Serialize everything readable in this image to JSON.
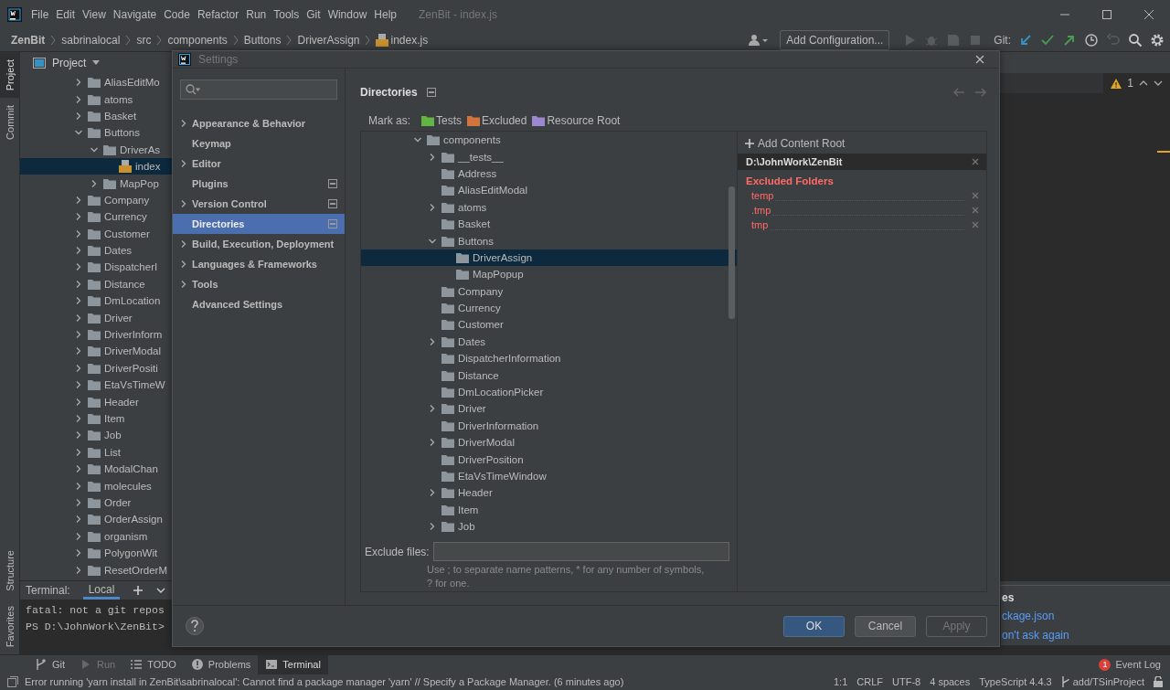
{
  "window": {
    "title": "ZenBit - index.js"
  },
  "menu": [
    "File",
    "Edit",
    "View",
    "Navigate",
    "Code",
    "Refactor",
    "Run",
    "Tools",
    "Git",
    "Window",
    "Help"
  ],
  "breadcrumbs": [
    {
      "label": "ZenBit",
      "kind": "project"
    },
    {
      "label": "sabrinalocal",
      "kind": "folder"
    },
    {
      "label": "src",
      "kind": "folder"
    },
    {
      "label": "components",
      "kind": "folder"
    },
    {
      "label": "Buttons",
      "kind": "folder"
    },
    {
      "label": "DriverAssign",
      "kind": "folder"
    },
    {
      "label": "index.js",
      "kind": "file"
    }
  ],
  "toolbar": {
    "run_configuration": "Add Configuration...",
    "vcs_label": "Git:"
  },
  "tool_stripe": {
    "top": [
      {
        "label": "Project",
        "selected": true
      },
      {
        "label": "Commit",
        "selected": false
      }
    ],
    "bottom": [
      {
        "label": "Structure",
        "selected": false
      },
      {
        "label": "Favorites",
        "selected": false
      }
    ]
  },
  "project_panel": {
    "title": "Project",
    "tree": [
      {
        "label": "AliasEditMo",
        "expanded": false,
        "selected": false
      },
      {
        "label": "atoms",
        "expanded": false,
        "selected": false
      },
      {
        "label": "Basket",
        "expanded": false,
        "selected": false
      },
      {
        "label": "Buttons",
        "expanded": true,
        "selected": false,
        "children": [
          {
            "label": "DriverAs",
            "expanded": true,
            "selected": false,
            "children": [
              {
                "label": "index",
                "kind": "file",
                "selected": true
              }
            ]
          },
          {
            "label": "MapPop",
            "expanded": false,
            "selected": false
          }
        ]
      },
      {
        "label": "Company",
        "expanded": false,
        "selected": false
      },
      {
        "label": "Currency",
        "expanded": false,
        "selected": false
      },
      {
        "label": "Customer",
        "expanded": false,
        "selected": false
      },
      {
        "label": "Dates",
        "expanded": false,
        "selected": false
      },
      {
        "label": "DispatcherI",
        "expanded": false,
        "selected": false
      },
      {
        "label": "Distance",
        "expanded": false,
        "selected": false
      },
      {
        "label": "DmLocation",
        "expanded": false,
        "selected": false
      },
      {
        "label": "Driver",
        "expanded": false,
        "selected": false
      },
      {
        "label": "DriverInform",
        "expanded": false,
        "selected": false
      },
      {
        "label": "DriverModal",
        "expanded": false,
        "selected": false
      },
      {
        "label": "DriverPositi",
        "expanded": false,
        "selected": false
      },
      {
        "label": "EtaVsTimeW",
        "expanded": false,
        "selected": false
      },
      {
        "label": "Header",
        "expanded": false,
        "selected": false
      },
      {
        "label": "Item",
        "expanded": false,
        "selected": false
      },
      {
        "label": "Job",
        "expanded": false,
        "selected": false
      },
      {
        "label": "List",
        "expanded": false,
        "selected": false
      },
      {
        "label": "ModalChan",
        "expanded": false,
        "selected": false
      },
      {
        "label": "molecules",
        "expanded": false,
        "selected": false
      },
      {
        "label": "Order",
        "expanded": false,
        "selected": false
      },
      {
        "label": "OrderAssign",
        "expanded": false,
        "selected": false
      },
      {
        "label": "organism",
        "expanded": false,
        "selected": false
      },
      {
        "label": "PolygonWit",
        "expanded": false,
        "selected": false
      },
      {
        "label": "ResetOrderM",
        "expanded": false,
        "selected": false
      }
    ]
  },
  "editor": {
    "warning_count": "1"
  },
  "terminal": {
    "label": "Terminal:",
    "tabs": [
      {
        "label": "Local",
        "selected": true
      }
    ],
    "lines": [
      "fatal: not a git repos",
      "PS D:\\JohnWork\\ZenBit>"
    ]
  },
  "notification": {
    "title": "es",
    "links": [
      "ckage.json",
      "on't ask again"
    ]
  },
  "tool_tabs": [
    {
      "label": "Git",
      "kind": "git",
      "selected": false,
      "disabled": false
    },
    {
      "label": "Run",
      "kind": "run",
      "selected": false,
      "disabled": true
    },
    {
      "label": "TODO",
      "kind": "todo",
      "selected": false,
      "disabled": false
    },
    {
      "label": "Problems",
      "kind": "problems",
      "selected": false,
      "disabled": false
    },
    {
      "label": "Terminal",
      "kind": "terminal",
      "selected": true,
      "disabled": false
    }
  ],
  "event_log": {
    "label": "Event Log",
    "count": "1"
  },
  "status_bar": {
    "message": "Error running 'yarn install in ZenBit\\sabrinalocal': Cannot find a package manager 'yarn' // Specify a Package Manager. (6 minutes ago)",
    "items": [
      "1:1",
      "CRLF",
      "UTF-8",
      "4 spaces",
      "TypeScript 4.4.3"
    ],
    "branch": "add/TSinProject"
  },
  "dialog": {
    "title": "Settings",
    "nav": [
      {
        "label": "Appearance & Behavior",
        "expandable": true,
        "selected": false,
        "project_level": false
      },
      {
        "label": "Keymap",
        "expandable": false,
        "selected": false,
        "project_level": false
      },
      {
        "label": "Editor",
        "expandable": true,
        "selected": false,
        "project_level": false
      },
      {
        "label": "Plugins",
        "expandable": false,
        "selected": false,
        "project_level": true
      },
      {
        "label": "Version Control",
        "expandable": true,
        "selected": false,
        "project_level": true
      },
      {
        "label": "Directories",
        "expandable": false,
        "selected": true,
        "project_level": true
      },
      {
        "label": "Build, Execution, Deployment",
        "expandable": true,
        "selected": false,
        "project_level": false
      },
      {
        "label": "Languages & Frameworks",
        "expandable": true,
        "selected": false,
        "project_level": false
      },
      {
        "label": "Tools",
        "expandable": true,
        "selected": false,
        "project_level": false
      },
      {
        "label": "Advanced Settings",
        "expandable": false,
        "selected": false,
        "project_level": false
      }
    ],
    "page": {
      "title": "Directories",
      "mark_as": {
        "label": "Mark as:",
        "options": [
          {
            "label": "Tests",
            "color": "#62b543"
          },
          {
            "label": "Excluded",
            "color": "#d3743c"
          },
          {
            "label": "Resource Root",
            "color": "#9d88cf"
          }
        ]
      },
      "tree": [
        {
          "label": "components",
          "expanded": true,
          "selected": false,
          "children": [
            {
              "label": "__tests__",
              "expanded": false,
              "selected": false
            },
            {
              "label": "Address",
              "selected": false
            },
            {
              "label": "AliasEditModal",
              "selected": false
            },
            {
              "label": "atoms",
              "expanded": false,
              "selected": false
            },
            {
              "label": "Basket",
              "selected": false
            },
            {
              "label": "Buttons",
              "expanded": true,
              "selected": false,
              "children": [
                {
                  "label": "DriverAssign",
                  "selected": true
                },
                {
                  "label": "MapPopup",
                  "selected": false
                }
              ]
            },
            {
              "label": "Company",
              "selected": false
            },
            {
              "label": "Currency",
              "selected": false
            },
            {
              "label": "Customer",
              "selected": false
            },
            {
              "label": "Dates",
              "expanded": false,
              "selected": false
            },
            {
              "label": "DispatcherInformation",
              "selected": false
            },
            {
              "label": "Distance",
              "selected": false
            },
            {
              "label": "DmLocationPicker",
              "selected": false
            },
            {
              "label": "Driver",
              "expanded": false,
              "selected": false
            },
            {
              "label": "DriverInformation",
              "selected": false
            },
            {
              "label": "DriverModal",
              "expanded": false,
              "selected": false
            },
            {
              "label": "DriverPosition",
              "selected": false
            },
            {
              "label": "EtaVsTimeWindow",
              "selected": false
            },
            {
              "label": "Header",
              "expanded": false,
              "selected": false
            },
            {
              "label": "Item",
              "selected": false
            },
            {
              "label": "Job",
              "expanded": false,
              "selected": false
            }
          ]
        }
      ],
      "exclude_files": {
        "label": "Exclude files:",
        "hint": "Use ; to separate name patterns, * for any number of symbols, ? for one."
      },
      "content_root": {
        "add_label": "Add Content Root",
        "path": "D:\\JohnWork\\ZenBit",
        "excluded_title": "Excluded Folders",
        "excluded": [
          "temp",
          ".tmp",
          "tmp"
        ]
      }
    },
    "buttons": [
      {
        "label": "OK",
        "kind": "primary",
        "disabled": false
      },
      {
        "label": "Cancel",
        "kind": "secondary",
        "disabled": false
      },
      {
        "label": "Apply",
        "kind": "secondary",
        "disabled": true
      }
    ]
  }
}
